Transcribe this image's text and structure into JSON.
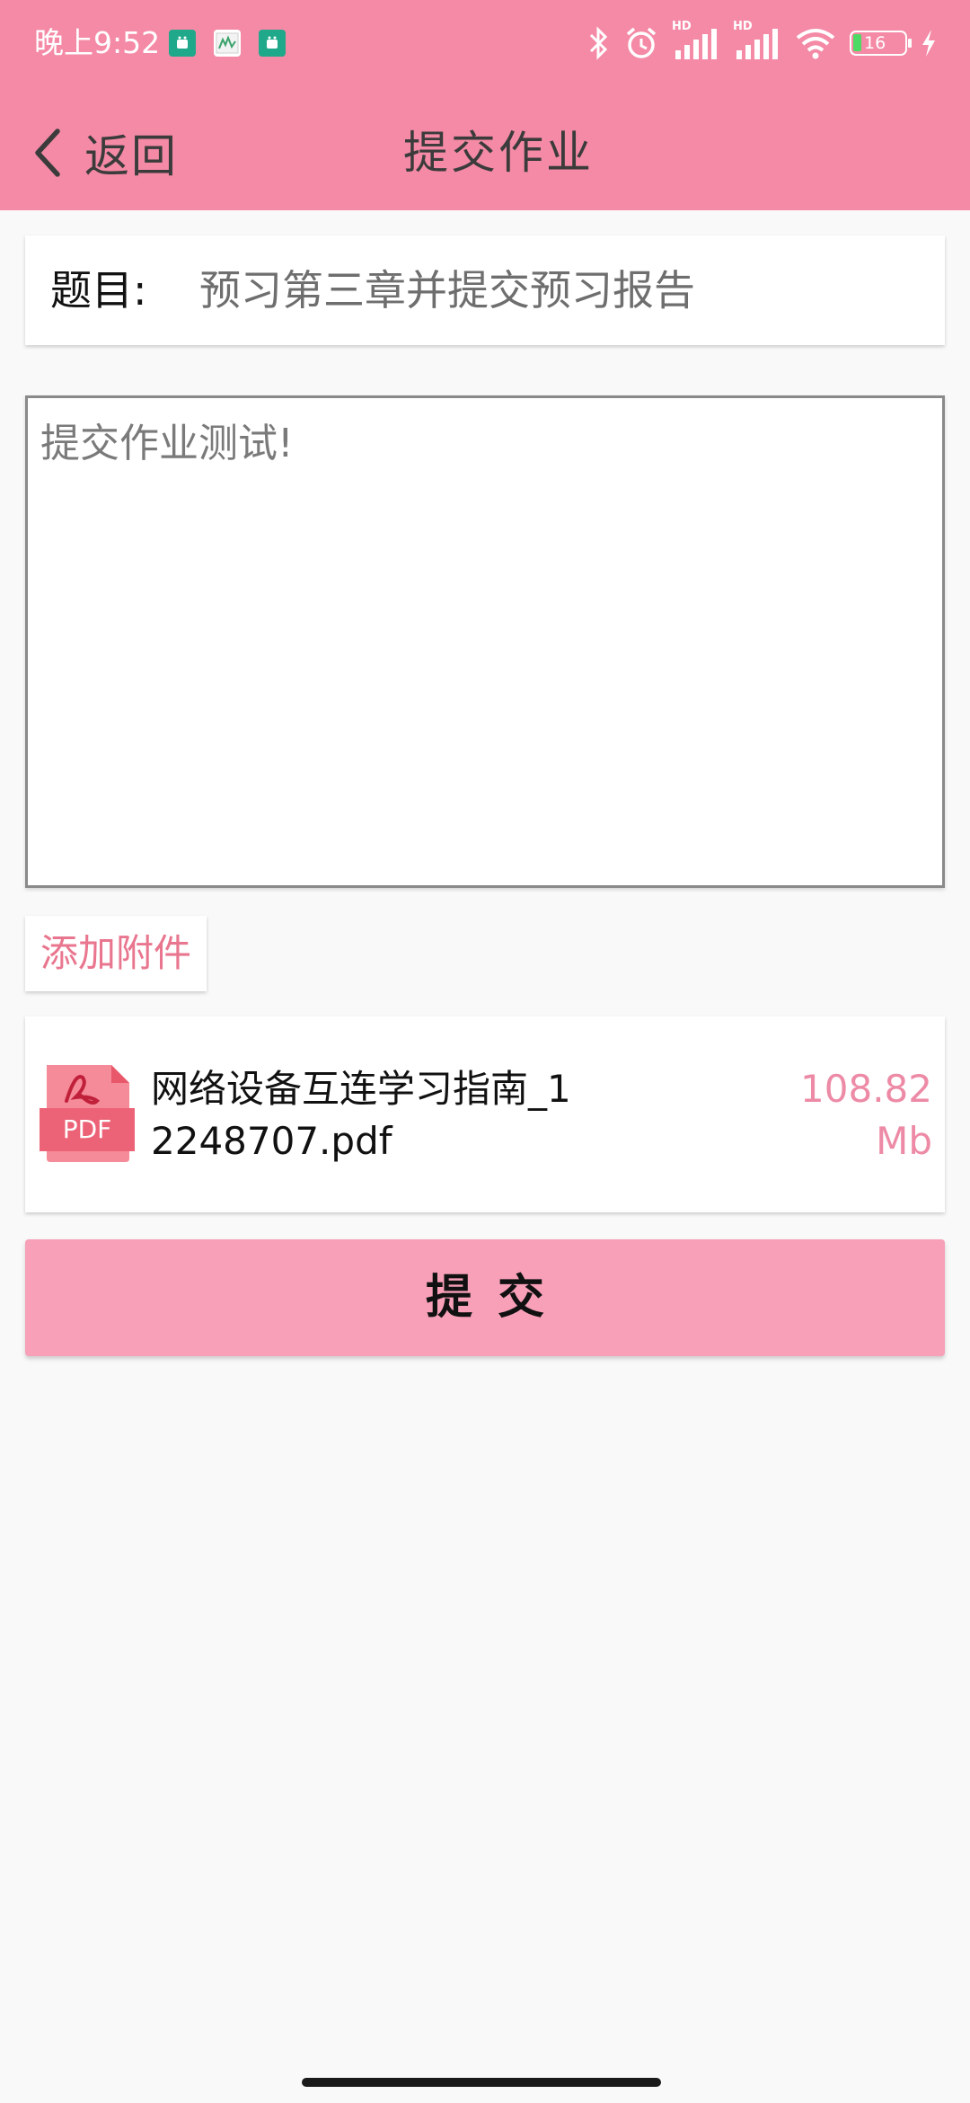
{
  "status_bar": {
    "time": "晚上9:52",
    "battery_level": "16",
    "icons": [
      "app-notification-icon",
      "image-notification-icon",
      "app-notification-icon",
      "bluetooth-icon",
      "alarm-icon",
      "signal-hd-icon",
      "signal-hd-icon",
      "wifi-icon",
      "battery-icon",
      "charging-icon"
    ],
    "signal_badge_1": "HD",
    "signal_badge_2": "HD"
  },
  "nav": {
    "back_label": "返回",
    "title": "提交作业"
  },
  "topic": {
    "label": "题目:",
    "value": "预习第三章并提交预习报告"
  },
  "content": {
    "text": "提交作业测试!"
  },
  "attachment": {
    "add_label": "添加附件",
    "file_type": "PDF",
    "file_name": "网络设备互连学习指南_12248707.pdf",
    "file_size": "108.82 Mb"
  },
  "submit": {
    "label": "提交"
  },
  "colors": {
    "header": "#f48aa6",
    "accent_text": "#e9768f",
    "submit_bg": "#f7a0b8",
    "pdf_icon": "#f0687a"
  }
}
